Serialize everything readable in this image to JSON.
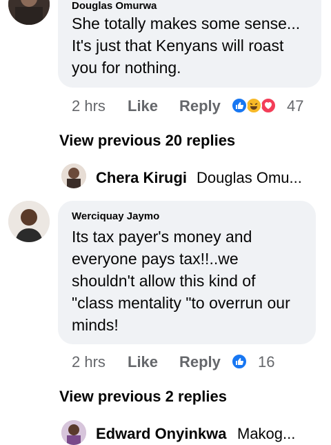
{
  "comment1": {
    "author": "Douglas Omurwa",
    "text_lines": [
      "She totally makes some sense...",
      "It's just that Kenyans will roast",
      "you for nothing."
    ],
    "time": "2 hrs",
    "like_label": "Like",
    "reply_label": "Reply",
    "reactions": [
      "like-icon",
      "haha-icon",
      "love-icon"
    ],
    "reaction_count": "47",
    "view_previous": "View previous 20 replies",
    "latest_reply": {
      "name": "Chera Kirugi",
      "snippet": "Douglas Omu..."
    }
  },
  "comment2": {
    "author": "Werciquay Jaymo",
    "text_lines": [
      "Its tax payer's money and",
      "everyone pays tax!!..we",
      "shouldn't allow this kind of",
      "\"class mentality \"to overrun our",
      "minds!"
    ],
    "time": "2 hrs",
    "like_label": "Like",
    "reply_label": "Reply",
    "reactions": [
      "like-icon"
    ],
    "reaction_count": "16",
    "view_previous": "View previous 2 replies",
    "latest_reply": {
      "name": "Edward Onyinkwa",
      "snippet": "Makog..."
    }
  },
  "colors": {
    "bubble": "#f0f2f5",
    "meta": "#65676b",
    "like_blue": "#1877f2",
    "haha_yellow": "#f7b928",
    "love_red": "#f33e58"
  }
}
